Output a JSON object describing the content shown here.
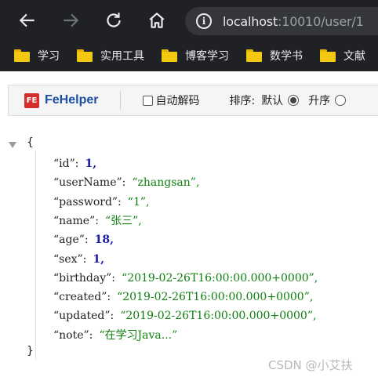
{
  "browser": {
    "url_host": "localhost",
    "url_rest": ":10010/user/1"
  },
  "bookmarks": [
    {
      "label": "学习"
    },
    {
      "label": "实用工具"
    },
    {
      "label": "博客学习"
    },
    {
      "label": "数学书"
    },
    {
      "label": "文献"
    }
  ],
  "fehelper": {
    "logo_text": "FE",
    "name": "FeHelper",
    "auto_decode_label": "自动解码",
    "sort_label": "排序:",
    "sort_default_label": "默认",
    "sort_asc_label": "升序"
  },
  "json_view": {
    "open_brace": "{",
    "close_brace": "}",
    "rows": [
      {
        "key": "“id”:",
        "value": "1,",
        "type": "num"
      },
      {
        "key": "“userName”:",
        "value": "“zhangsan”,",
        "type": "str"
      },
      {
        "key": "“password”:",
        "value": "“1”,",
        "type": "str"
      },
      {
        "key": "“name”:",
        "value": "“张三”,",
        "type": "str"
      },
      {
        "key": "“age”:",
        "value": "18,",
        "type": "num"
      },
      {
        "key": "“sex”:",
        "value": "1,",
        "type": "num"
      },
      {
        "key": "“birthday”:",
        "value": "“2019-02-26T16:00:00.000+0000”,",
        "type": "str"
      },
      {
        "key": "“created”:",
        "value": "“2019-02-26T16:00:00.000+0000”,",
        "type": "str"
      },
      {
        "key": "“updated”:",
        "value": "“2019-02-26T16:00:00.000+0000”,",
        "type": "str"
      },
      {
        "key": "“note”:",
        "value": "“在学习Java...”",
        "type": "str"
      }
    ]
  },
  "watermark": "CSDN @小艾扶"
}
